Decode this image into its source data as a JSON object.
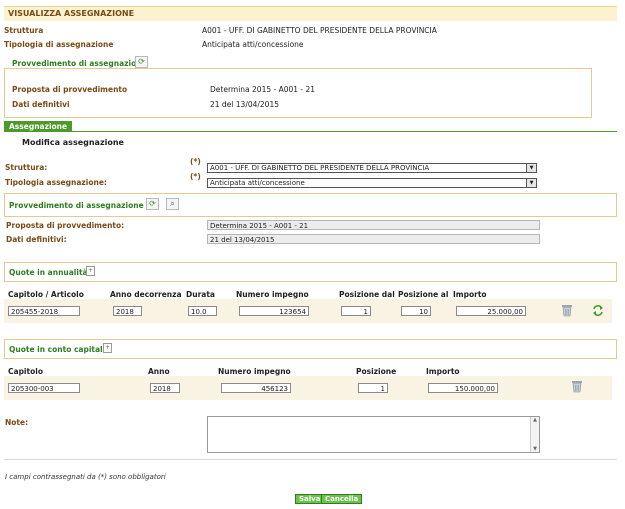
{
  "header": {
    "title": "VISUALIZZA ASSEGNAZIONE"
  },
  "summary": {
    "struttura_label": "Struttura",
    "struttura_value": "A001 - UFF. DI GABINETTO DEL PRESIDENTE DELLA PROVINCIA",
    "tipologia_label": "Tipologia di assegnazione",
    "tipologia_value": "Anticipata atti/concessione",
    "provvedimento_title": "Provvedimento di assegnazione",
    "proposta_label": "Proposta di provvedimento",
    "proposta_value": "Determina 2015 - A001 - 21",
    "dati_label": "Dati definitivi",
    "dati_value": "21 del 13/04/2015"
  },
  "tab": {
    "label": "Assegnazione"
  },
  "form": {
    "section_title": "Modifica assegnazione",
    "required_marker": "(*)",
    "struttura_label": "Struttura:",
    "struttura_value": "A001 - UFF. DI GABINETTO DEL PRESIDENTE DELLA PROVINCIA",
    "tipologia_label": "Tipologia assegnazione:",
    "tipologia_value": "Anticipata atti/concessione",
    "provvedimento_title": "Provvedimento di assegnazione (*)",
    "proposta_label": "Proposta di provvedimento:",
    "proposta_value": "Determina 2015 - A001 - 21",
    "dati_label": "Dati definitivi:",
    "dati_value": "21 del 13/04/2015"
  },
  "annualita": {
    "title": "Quote in annualità",
    "columns": [
      "Capitolo / Articolo",
      "Anno decorrenza",
      "Durata",
      "Numero impegno",
      "Posizione dal",
      "Posizione al",
      "Importo"
    ],
    "row": {
      "capitolo": "205455-2018",
      "anno": "2018",
      "durata": "10.0",
      "numero": "123654",
      "pos_dal": "1",
      "pos_al": "10",
      "importo": "25.000,00"
    }
  },
  "conto_capitale": {
    "title": "Quote in conto capitale",
    "columns": [
      "Capitolo",
      "Anno",
      "Numero impegno",
      "Posizione",
      "Importo"
    ],
    "row": {
      "capitolo": "205300-003",
      "anno": "2018",
      "numero": "456123",
      "posizione": "1",
      "importo": "150.000,00"
    }
  },
  "note": {
    "label": "Note:",
    "value": ""
  },
  "footer": {
    "required_note": "I campi contrassegnati da (*) sono obbligatori",
    "save_label": "Salva",
    "cancel_label": "Cancella"
  },
  "colors": {
    "accent_green": "#4c9a2a",
    "label_brown": "#7a4a16",
    "header_bg": "#fdf2cf",
    "box_border": "#e6c98e"
  }
}
